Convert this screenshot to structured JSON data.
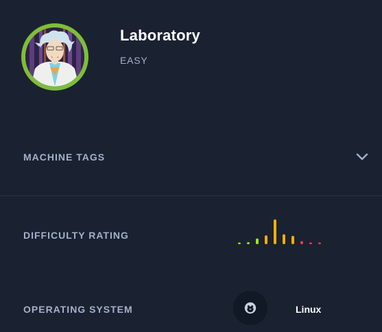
{
  "header": {
    "machine_name": "Laboratory",
    "difficulty": "EASY",
    "avatar": "rick-scientist-avatar"
  },
  "rows": {
    "tags_label": "MACHINE TAGS",
    "tags_icon": "chevron-down-icon",
    "difficulty_label": "DIFFICULTY RATING",
    "os_label": "OPERATING SYSTEM",
    "os_value": "Linux",
    "os_icon": "linux-tux-icon"
  },
  "difficulty_rating": {
    "votes": [
      0.06,
      0.08,
      0.22,
      0.34,
      0.95,
      0.38,
      0.32,
      0.12,
      0.05,
      0.05
    ],
    "colors": [
      "#9fef00",
      "#9fef00",
      "#9fef00",
      "#ffaf00",
      "#ffaf00",
      "#ffaf00",
      "#ffaf00",
      "#ff3e3e",
      "#ff3e3e",
      "#ff3e3e"
    ]
  },
  "colors": {
    "background": "#1a2231",
    "easy_green": "#9fef00",
    "medium_orange": "#ffaf00",
    "hard_red": "#ff3e3e"
  }
}
